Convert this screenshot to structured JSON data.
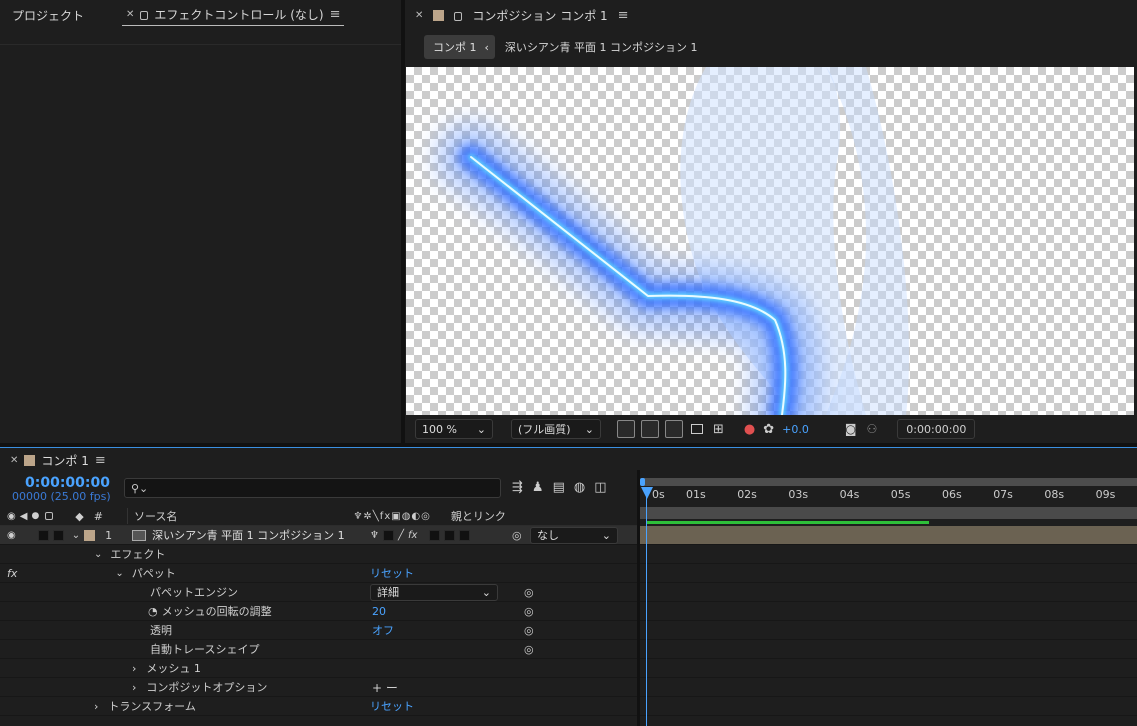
{
  "project_panel": {
    "title": "プロジェクト"
  },
  "effect_controls_panel": {
    "title": "エフェクトコントロール (なし)"
  },
  "comp_panel": {
    "title": "コンポジション コンポ 1",
    "breadcrumb_current": "コンポ 1",
    "breadcrumb_next": "深いシアン青 平面 1 コンポジション 1",
    "zoom": "100 %",
    "resolution": "(フル画質)",
    "exposure": "+0.0",
    "timecode": "0:00:00:00"
  },
  "timeline": {
    "tab_label": "コンポ 1",
    "current_time": "0:00:00:00",
    "frame_info": "00000 (25.00 fps)",
    "search_placeholder": "",
    "col_hash": "#",
    "col_source": "ソース名",
    "col_parent": "親とリンク",
    "ruler_labels": [
      "0s",
      "01s",
      "02s",
      "03s",
      "04s",
      "05s",
      "06s",
      "07s",
      "08s",
      "09s"
    ],
    "layer": {
      "number": "1",
      "name": "深いシアン青 平面 1 コンポジション 1",
      "parent": "なし"
    },
    "effects_group": "エフェクト",
    "fx_label": "fx",
    "puppet": {
      "name": "パペット",
      "reset": "リセット"
    },
    "props": {
      "engine_label": "パペットエンジン",
      "engine_value": "詳細",
      "mesh_rotation_label": "メッシュの回転の調整",
      "mesh_rotation_value": "20",
      "transparent_label": "透明",
      "transparent_value": "オフ",
      "auto_trace_label": "自動トレースシェイプ",
      "mesh_label": "メッシュ 1",
      "composite_label": "コンポジットオプション",
      "composite_value": "+ ー"
    },
    "transform": {
      "label": "トランスフォーム",
      "reset": "リセット"
    }
  },
  "colors": {
    "accent": "#4aa3ff",
    "comp_swatch": "#bca58a",
    "work_bar": "#2fbf3a",
    "layer_bar": "#6b6252"
  }
}
